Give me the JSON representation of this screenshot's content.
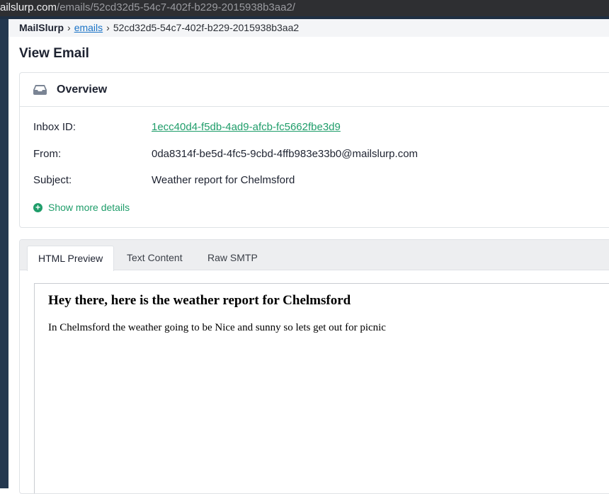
{
  "browser": {
    "url_host": "ailslurp.com",
    "url_path": "/emails/52cd32d5-54c7-402f-b229-2015938b3aa2/"
  },
  "breadcrumb": {
    "root": "MailSlurp",
    "separator": "›",
    "link": "emails",
    "current": "52cd32d5-54c7-402f-b229-2015938b3aa2"
  },
  "page": {
    "title": "View Email"
  },
  "overview": {
    "title": "Overview",
    "icon": "inbox-tray-icon",
    "fields": [
      {
        "label": "Inbox ID:",
        "value": "1ecc40d4-f5db-4ad9-afcb-fc5662fbe3d9"
      },
      {
        "label": "From:",
        "value": "0da8314f-be5d-4fc5-9cbd-4ffb983e33b0@mailslurp.com"
      },
      {
        "label": "Subject:",
        "value": "Weather report for Chelmsford"
      }
    ],
    "show_more": "Show more details"
  },
  "tabs": [
    {
      "label": "HTML Preview",
      "active": true
    },
    {
      "label": "Text Content",
      "active": false
    },
    {
      "label": "Raw SMTP",
      "active": false
    }
  ],
  "preview": {
    "heading": "Hey there, here is the weather report for Chelmsford",
    "body": "In Chelmsford the weather going to be Nice and sunny so lets get out for picnic"
  },
  "colors": {
    "accent_green": "#1f9d6a",
    "link_blue": "#1a73c7",
    "sidebar": "#24384f"
  }
}
